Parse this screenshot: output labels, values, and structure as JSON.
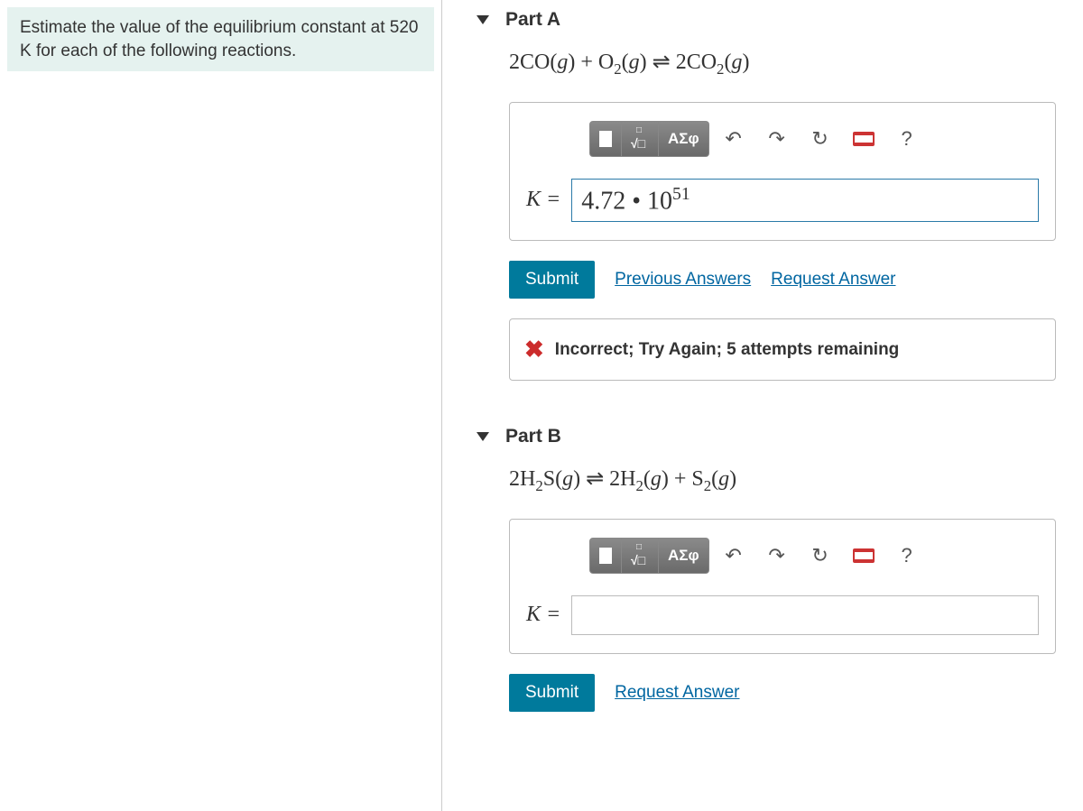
{
  "question": "Estimate the value of the equilibrium constant at 520 K for each of the following reactions.",
  "partA": {
    "title": "Part A",
    "equation_html": "2CO(<i>g</i>) + O<sub>2</sub>(<i>g</i>) ⇌ 2CO<sub>2</sub>(<i>g</i>)",
    "input_label": "K =",
    "input_value_html": "4.72 • 10<sup>51</sup>",
    "submit": "Submit",
    "previous": "Previous Answers",
    "request": "Request Answer",
    "feedback": "Incorrect; Try Again; 5 attempts remaining"
  },
  "partB": {
    "title": "Part B",
    "equation_html": "2H<sub>2</sub>S(<i>g</i>) ⇌ 2H<sub>2</sub>(<i>g</i>) + S<sub>2</sub>(<i>g</i>)",
    "input_label": "K =",
    "input_value_html": "",
    "submit": "Submit",
    "request": "Request Answer"
  },
  "toolbar": {
    "greek": "ΑΣφ",
    "undo": "↶",
    "redo": "↷",
    "reset": "↻",
    "help": "?"
  }
}
